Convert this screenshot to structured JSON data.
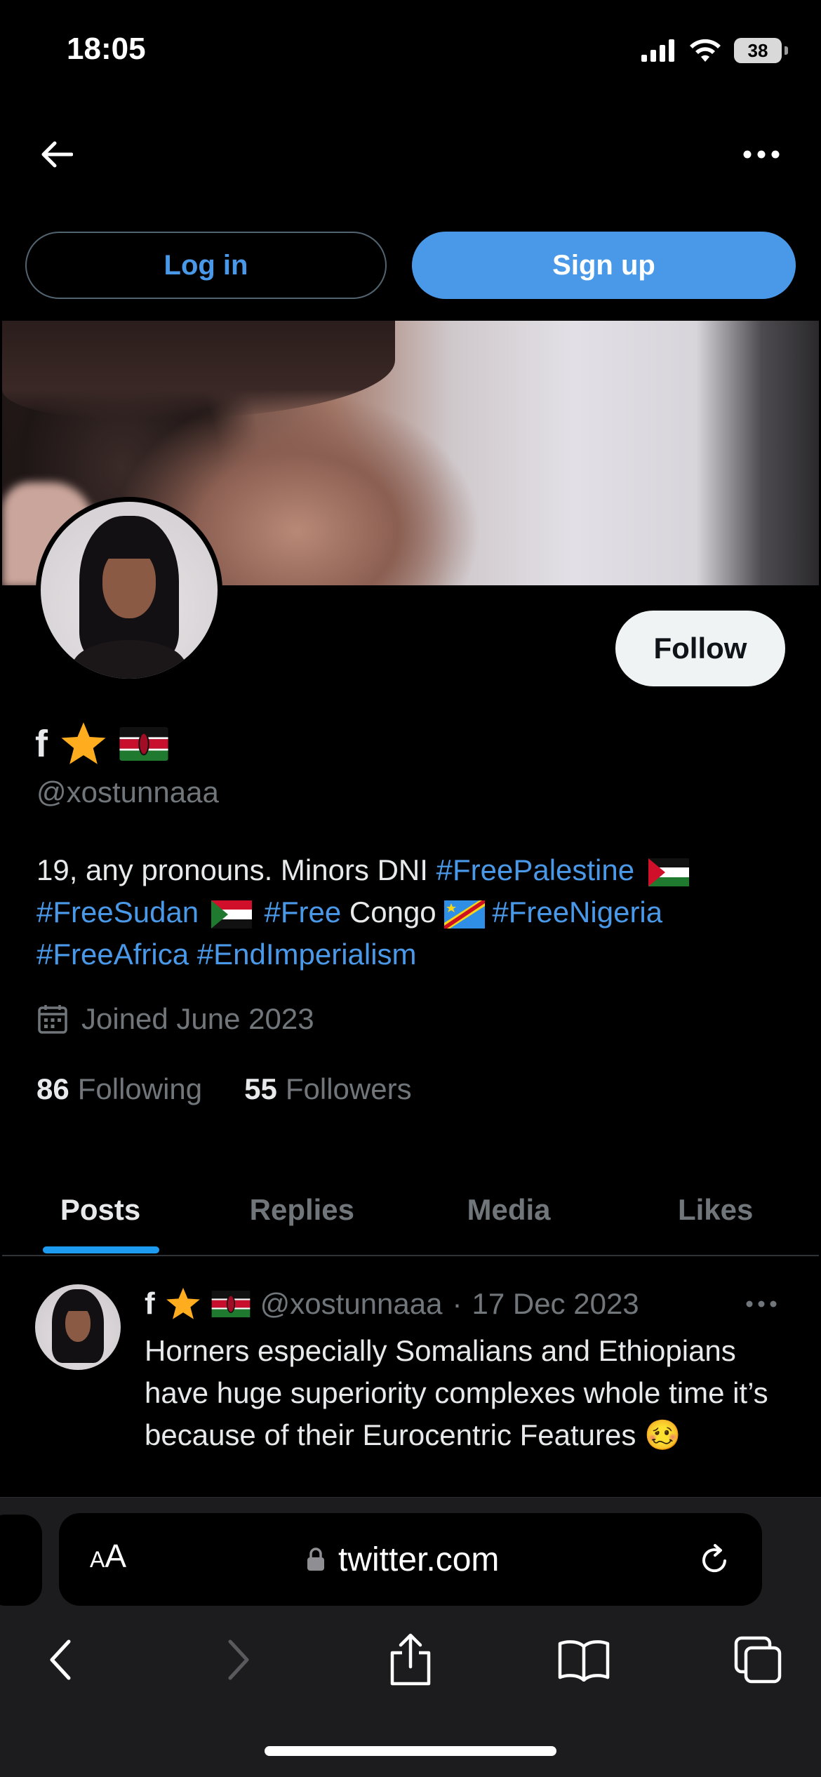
{
  "status_bar": {
    "time": "18:05",
    "battery": "38"
  },
  "header": {
    "back_icon": "arrow-left-icon",
    "more_icon": "more-horizontal-icon"
  },
  "auth": {
    "login_label": "Log in",
    "signup_label": "Sign up"
  },
  "profile": {
    "name": "f",
    "handle": "@xostunnaaa",
    "follow_label": "Follow",
    "bio": {
      "part1": "19, any pronouns. Minors DNI ",
      "tag_palestine": "#FreePalestine",
      "tag_sudan": "#FreeSudan",
      "tag_free": "#Free",
      "congo": " Congo ",
      "tag_nigeria": "#FreeNigeria",
      "tag_africa": "#FreeAfrica",
      "tag_imperialism": "#EndImperialism"
    },
    "joined": "Joined June 2023",
    "following_count": "86",
    "following_label": "Following",
    "followers_count": "55",
    "followers_label": "Followers"
  },
  "tabs": [
    {
      "label": "Posts",
      "active": true
    },
    {
      "label": "Replies",
      "active": false
    },
    {
      "label": "Media",
      "active": false
    },
    {
      "label": "Likes",
      "active": false
    }
  ],
  "tweet": {
    "name": "f",
    "handle": "@xostunnaaa",
    "separator": "·",
    "date": "17 Dec 2023",
    "text": "Horners especially Somalians and Ethiopians have huge superiority complexes whole time it’s because of their Eurocentric Features",
    "emoji": "🥴"
  },
  "browser": {
    "aa_small": "A",
    "aa_large": "A",
    "url": "twitter.com"
  },
  "colors": {
    "accent": "#1d9bf0",
    "link": "#4a99e9",
    "muted": "#71767b",
    "star": "#ffad1f"
  }
}
